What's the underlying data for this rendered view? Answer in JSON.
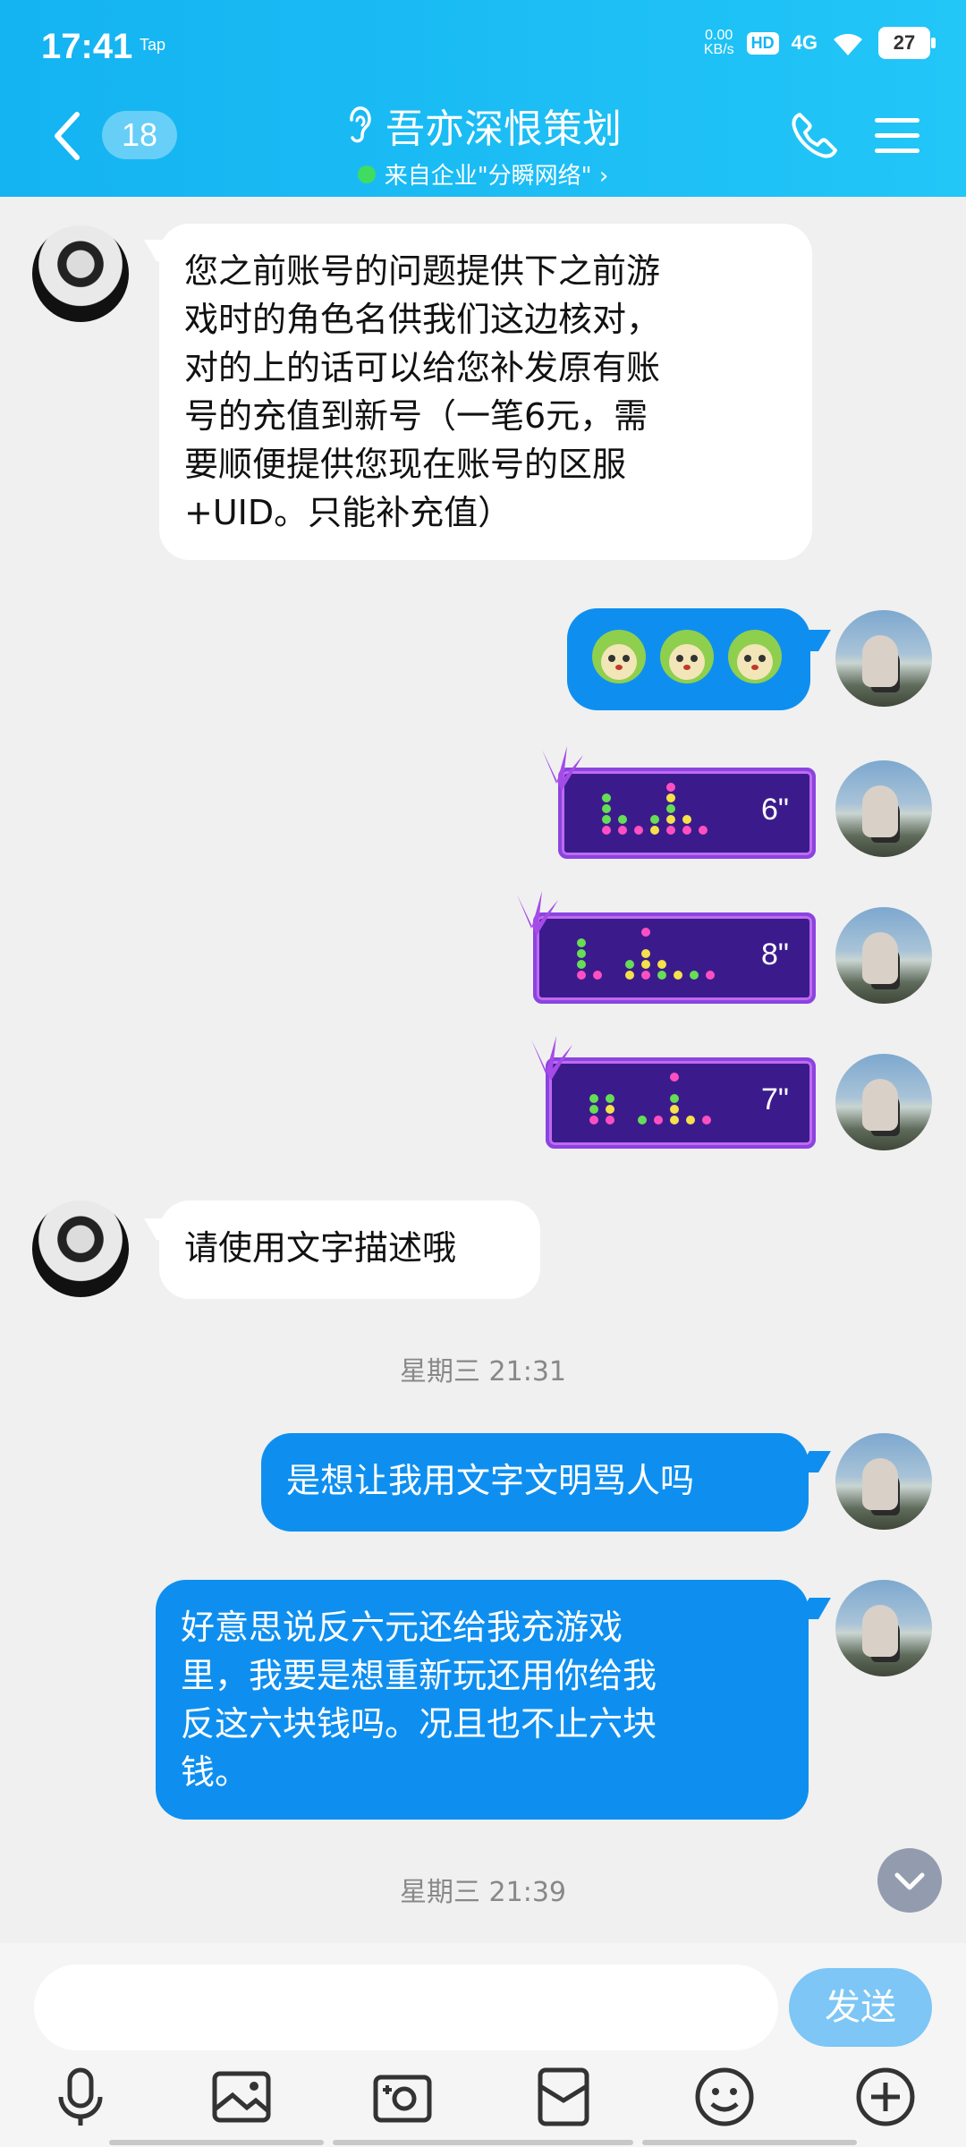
{
  "status_bar": {
    "time": "17:41",
    "tap": "Tap",
    "net_speed_value": "0.00",
    "net_speed_unit": "KB/s",
    "hd": "HD",
    "signal": "4G",
    "battery": "27"
  },
  "header": {
    "unread_count": "18",
    "title": "吾亦深恨策划",
    "subtitle": "来自企业\"分瞬网络\" ›",
    "colors": {
      "header_bg": "#17b8f4",
      "online_dot": "#3fdc61"
    }
  },
  "messages": [
    {
      "side": "in",
      "type": "text",
      "text_lines": [
        "您之前账号的问题提供下之前游",
        "戏时的角色名供我们这边核对，",
        "对的上的话可以给您补发原有账",
        "号的充值到新号（一笔6元，需",
        "要顺便提供您现在账号的区服",
        "+UID。只能补充值）"
      ]
    },
    {
      "side": "out",
      "type": "emoji",
      "emoji_icons": [
        "cabbage-dog-emoji",
        "cabbage-dog-emoji",
        "cabbage-dog-emoji"
      ]
    },
    {
      "side": "out",
      "type": "voice",
      "duration": "6\""
    },
    {
      "side": "out",
      "type": "voice",
      "duration": "8\""
    },
    {
      "side": "out",
      "type": "voice",
      "duration": "7\""
    },
    {
      "side": "in",
      "type": "text",
      "text_lines": [
        "请使用文字描述哦"
      ]
    },
    {
      "type": "timestamp",
      "text": "星期三 21:31"
    },
    {
      "side": "out",
      "type": "text",
      "text_lines": [
        "是想让我用文字文明骂人吗"
      ]
    },
    {
      "side": "out",
      "type": "text",
      "text_lines": [
        "好意思说反六元还给我充游戏",
        "里，我要是想重新玩还用你给我",
        "反这六块钱吗。况且也不止六块",
        "钱。"
      ]
    },
    {
      "type": "timestamp",
      "text": "星期三 21:39"
    }
  ],
  "composer": {
    "input_value": "",
    "send_label": "发送",
    "tools": [
      "microphone-icon",
      "image-icon",
      "camera-icon",
      "red-packet-icon",
      "emoji-icon",
      "plus-icon"
    ]
  },
  "colors": {
    "out_bubble": "#0e8ff0",
    "in_bubble": "#ffffff",
    "chat_bg": "#f0f0f0",
    "send_button": "#7dc6f6"
  }
}
